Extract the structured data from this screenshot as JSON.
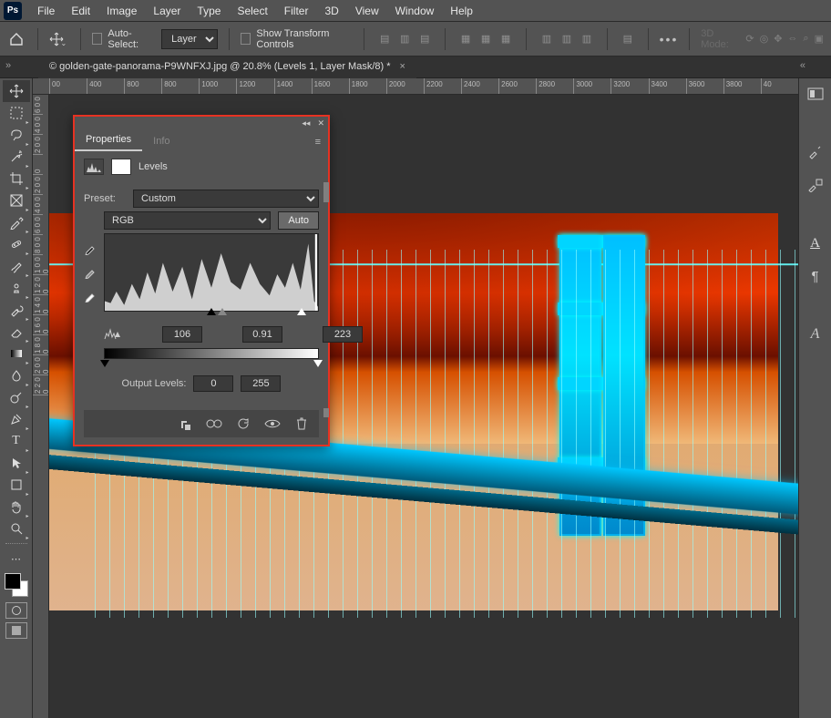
{
  "app": {
    "logo": "Ps"
  },
  "menu": [
    "File",
    "Edit",
    "Image",
    "Layer",
    "Type",
    "Select",
    "Filter",
    "3D",
    "View",
    "Window",
    "Help"
  ],
  "options": {
    "auto_select_label": "Auto-Select:",
    "auto_select_target": "Layer",
    "show_transform_label": "Show Transform Controls",
    "mode3d_label": "3D Mode:"
  },
  "document": {
    "tab_title": "© golden-gate-panorama-P9WNFXJ.jpg @ 20.8% (Levels 1, Layer Mask/8) *"
  },
  "ruler_h": [
    "00",
    "400",
    "800",
    "800",
    "1000",
    "1200",
    "1400",
    "1600",
    "1800",
    "2000",
    "2200",
    "2400",
    "2600",
    "2800",
    "3000",
    "3200",
    "3400",
    "3600",
    "3800",
    "40"
  ],
  "ruler_v": [
    "6 0 0",
    "4 0 0",
    "2 0 0",
    "0",
    "2 0 0",
    "4 0 0",
    "6 0 0",
    "8 0 0",
    "1 0 0 0",
    "1 2 0 0",
    "1 4 0 0",
    "1 6 0 0",
    "1 8 0 0",
    "2 0 0 0",
    "2 2 0 0"
  ],
  "panel": {
    "tab_properties": "Properties",
    "tab_info": "Info",
    "adjustment_name": "Levels",
    "preset_label": "Preset:",
    "preset_value": "Custom",
    "channel_value": "RGB",
    "auto_label": "Auto",
    "shadow_input": "106",
    "mid_input": "0.91",
    "highlight_input": "223",
    "output_label": "Output Levels:",
    "output_lo": "0",
    "output_hi": "255"
  }
}
